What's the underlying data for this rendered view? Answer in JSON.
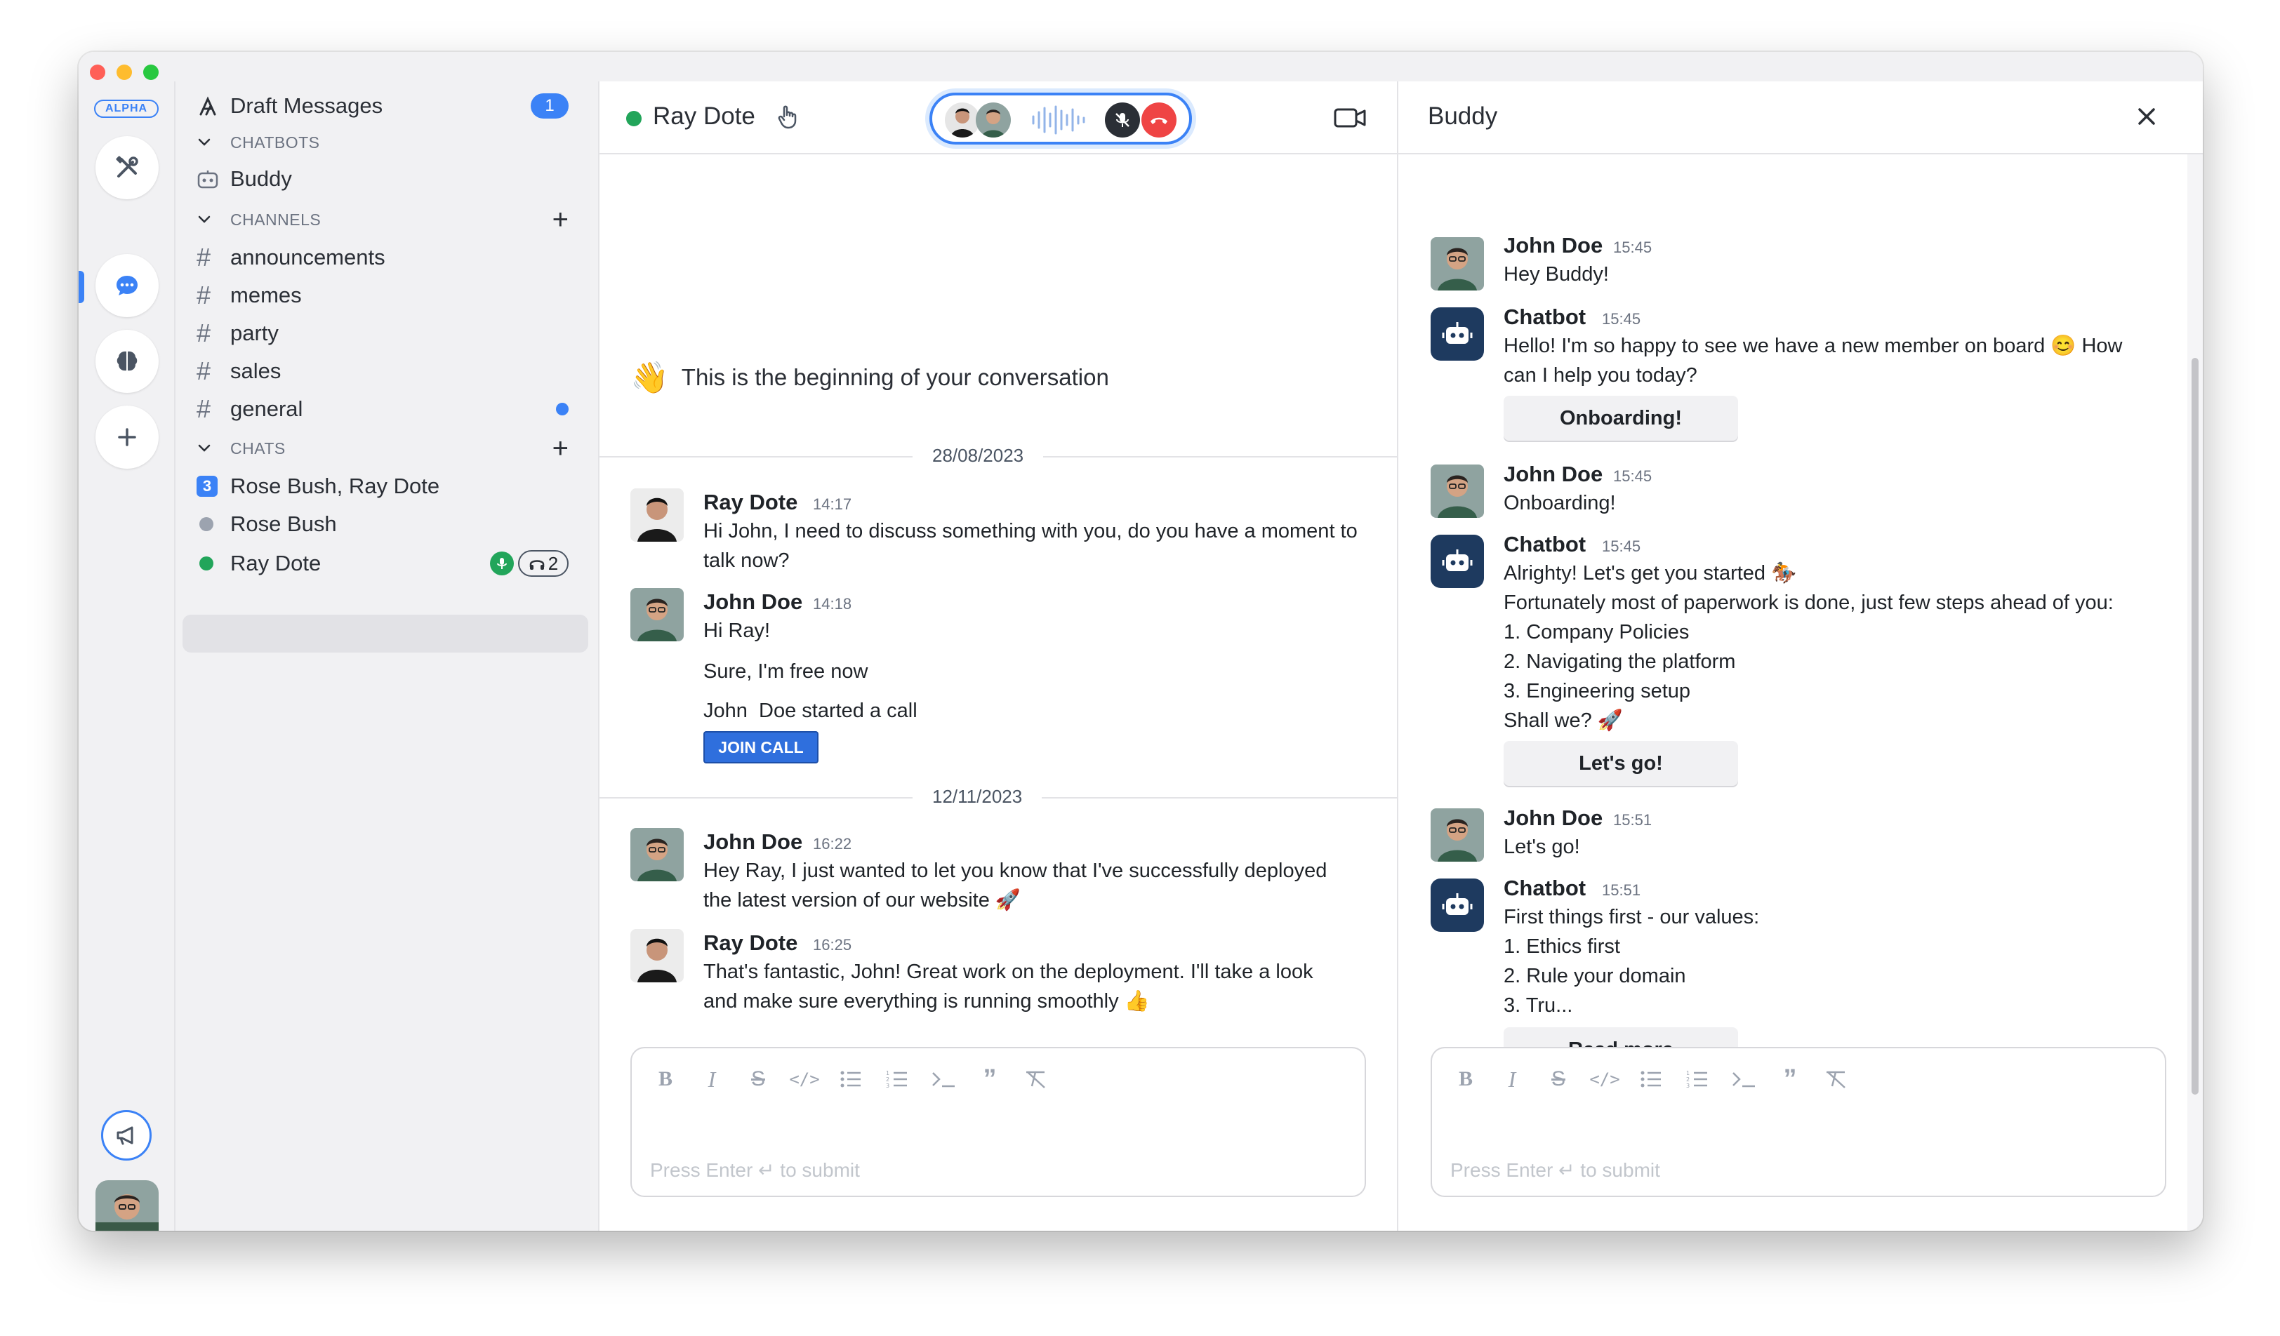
{
  "rail": {
    "alpha_badge": "ALPHA"
  },
  "sidebar": {
    "draft_label": "Draft Messages",
    "draft_count": "1",
    "chatbots_header": "CHATBOTS",
    "chatbots": [
      {
        "label": "Buddy"
      }
    ],
    "channels_header": "CHANNELS",
    "channels": [
      {
        "label": "announcements"
      },
      {
        "label": "memes"
      },
      {
        "label": "party"
      },
      {
        "label": "sales"
      },
      {
        "label": "general"
      }
    ],
    "chats_header": "CHATS",
    "chats": [
      {
        "label": "Rose Bush, Ray Dote",
        "badge": "3"
      },
      {
        "label": "Rose Bush"
      },
      {
        "label": "Ray Dote",
        "listeners": "2"
      }
    ]
  },
  "main": {
    "title": "Ray Dote",
    "intro_emoji": "👋",
    "intro_text": "This is the beginning of your conversation",
    "date_1": "28/08/2023",
    "date_2": "12/11/2023",
    "messages": [
      {
        "name": "Ray Dote",
        "time": "14:17",
        "text": "Hi John, I need to discuss something with you, do you have a moment to\ntalk now?"
      },
      {
        "name": "John Doe",
        "time": "14:18",
        "text": "Hi Ray!"
      },
      {
        "text": "Sure, I'm free now"
      },
      {
        "text": "John  Doe started a call"
      },
      {
        "name": "John Doe",
        "time": "16:22",
        "text": "Hey Ray, I just wanted to let you know that I've successfully deployed\nthe latest version of our website 🚀"
      },
      {
        "name": "Ray Dote",
        "time": "16:25",
        "text": "That's fantastic, John! Great work on the deployment. I'll take a look\nand make sure everything is running smoothly 👍"
      }
    ],
    "join_call_label": "JOIN CALL",
    "composer_hint": "Press Enter ↵ to submit"
  },
  "buddy": {
    "title": "Buddy",
    "messages": [
      {
        "name": "John Doe",
        "time": "15:45",
        "text": "Hey Buddy!"
      },
      {
        "name": "Chatbot",
        "time": "15:45",
        "text": "Hello! I'm so happy to see we have a new member on board 😊 How\ncan I help you today?",
        "button": "Onboarding!"
      },
      {
        "name": "John Doe",
        "time": "15:45",
        "text": "Onboarding!"
      },
      {
        "name": "Chatbot",
        "time": "15:45",
        "text": "Alrighty! Let's get you started 🏇\nFortunately most of paperwork is done, just few steps ahead of you:\n1. Company Policies\n2. Navigating the platform\n3. Engineering setup\nShall we? 🚀",
        "button": "Let's go!"
      },
      {
        "name": "John Doe",
        "time": "15:51",
        "text": "Let's go!"
      },
      {
        "name": "Chatbot",
        "time": "15:51",
        "text": "First things first - our values:\n1. Ethics first\n2. Rule your domain\n3. Tru...",
        "button": "Read more"
      }
    ],
    "composer_hint": "Press Enter ↵ to submit"
  },
  "colors": {
    "accent": "#3b82f6",
    "online": "#22a55a",
    "hangup": "#ef4444",
    "bot_avatar": "#1e3a5f"
  }
}
